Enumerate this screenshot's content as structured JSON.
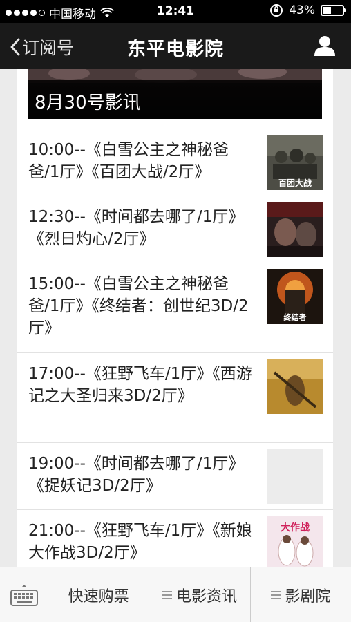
{
  "status_bar": {
    "carrier": "中国移动",
    "time": "12:41",
    "battery": "43%",
    "battery_level": 0.43
  },
  "nav": {
    "back_label": "订阅号",
    "title": "东平电影院"
  },
  "banner": {
    "caption": "8月30号影讯"
  },
  "schedule": [
    {
      "text": "10:00--《白雪公主之神秘爸爸/1厅》《百团大战/2厅》",
      "thumb_caption": "百团大战"
    },
    {
      "text": "12:30--《时间都去哪了/1厅》《烈日灼心/2厅》",
      "thumb_caption": ""
    },
    {
      "text": "15:00--《白雪公主之神秘爸爸/1厅》《终结者：创世纪3D/2厅》",
      "thumb_caption": "终结者"
    },
    {
      "text": "17:00--《狂野飞车/1厅》《西游记之大圣归来3D/2厅》",
      "thumb_caption": ""
    },
    {
      "text": "19:00--《时间都去哪了/1厅》《捉妖记3D/2厅》",
      "thumb_caption": ""
    },
    {
      "text": "21:00--《狂野飞车/1厅》《新娘大作战3D/2厅》",
      "thumb_caption": "大作战"
    }
  ],
  "bottom_bar": {
    "item1": "快速购票",
    "item2": "电影资讯",
    "item3": "影剧院"
  }
}
